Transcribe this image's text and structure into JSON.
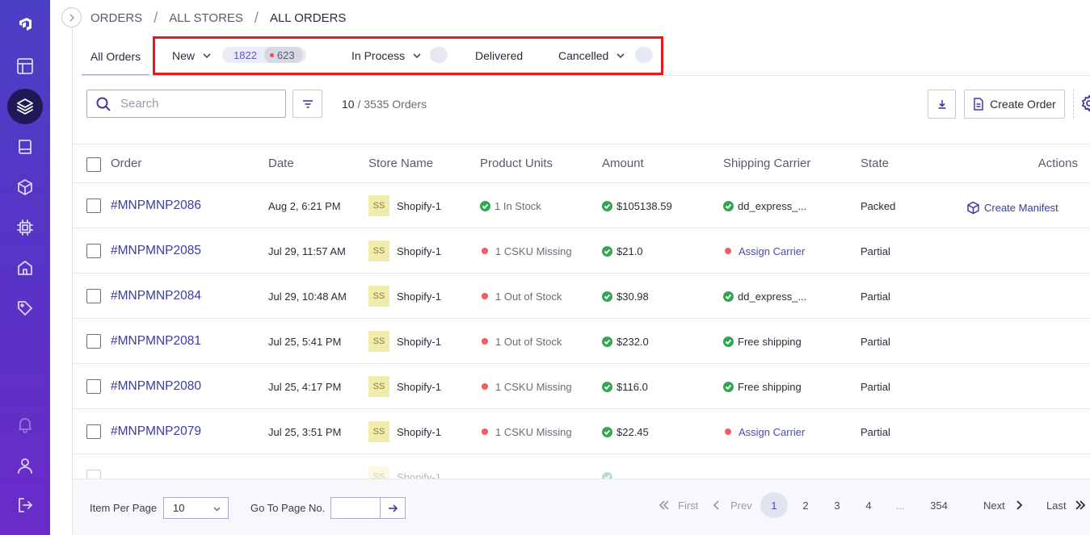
{
  "breadcrumb": {
    "level1": "ORDERS",
    "level2": "ALL STORES",
    "level3": "ALL ORDERS",
    "separator": "/"
  },
  "tabs": {
    "all": "All Orders",
    "new": {
      "label": "New",
      "count_a": "1822",
      "count_b": "623"
    },
    "in_process": {
      "label": "In Process"
    },
    "delivered": {
      "label": "Delivered"
    },
    "cancelled": {
      "label": "Cancelled"
    }
  },
  "toolbar": {
    "search_placeholder": "Search",
    "count_shown": "10",
    "count_total": "/ 3535 Orders",
    "create_label": "Create Order"
  },
  "table": {
    "headers": [
      "Order",
      "Date",
      "Store Name",
      "Product Units",
      "Amount",
      "Shipping Carrier",
      "State",
      "Actions"
    ],
    "rows": [
      {
        "order": "#MNPMNP2086",
        "date": "Aug 2, 6:21 PM",
        "store_abbr": "SS",
        "store": "Shopify-1",
        "units": "1 In Stock",
        "units_ok": true,
        "amount": "$105138.59",
        "carrier": "dd_express_...",
        "carrier_ok": true,
        "state": "Packed",
        "action": "Create Manifest"
      },
      {
        "order": "#MNPMNP2085",
        "date": "Jul 29, 11:57 AM",
        "store_abbr": "SS",
        "store": "Shopify-1",
        "units": "1 CSKU Missing",
        "units_ok": false,
        "amount": "$21.0",
        "carrier": "Assign Carrier",
        "carrier_ok": false,
        "state": "Partial",
        "action": ""
      },
      {
        "order": "#MNPMNP2084",
        "date": "Jul 29, 10:48 AM",
        "store_abbr": "SS",
        "store": "Shopify-1",
        "units": "1 Out of Stock",
        "units_ok": false,
        "amount": "$30.98",
        "carrier": "dd_express_...",
        "carrier_ok": true,
        "state": "Partial",
        "action": ""
      },
      {
        "order": "#MNPMNP2081",
        "date": "Jul 25, 5:41 PM",
        "store_abbr": "SS",
        "store": "Shopify-1",
        "units": "1 Out of Stock",
        "units_ok": false,
        "amount": "$232.0",
        "carrier": "Free shipping",
        "carrier_ok": true,
        "state": "Partial",
        "action": ""
      },
      {
        "order": "#MNPMNP2080",
        "date": "Jul 25, 4:17 PM",
        "store_abbr": "SS",
        "store": "Shopify-1",
        "units": "1 CSKU Missing",
        "units_ok": false,
        "amount": "$116.0",
        "carrier": "Free shipping",
        "carrier_ok": true,
        "state": "Partial",
        "action": ""
      },
      {
        "order": "#MNPMNP2079",
        "date": "Jul 25, 3:51 PM",
        "store_abbr": "SS",
        "store": "Shopify-1",
        "units": "1 CSKU Missing",
        "units_ok": false,
        "amount": "$22.45",
        "carrier": "Assign Carrier",
        "carrier_ok": false,
        "state": "Partial",
        "action": ""
      },
      {
        "order": "",
        "date": "",
        "store_abbr": "SS",
        "store": "Shopify-1",
        "units": "",
        "units_ok": true,
        "amount": "",
        "carrier": "",
        "carrier_ok": true,
        "state": "",
        "action": ""
      }
    ]
  },
  "footer": {
    "per_page_label": "Item Per Page",
    "per_page_value": "10",
    "goto_label": "Go To Page No.",
    "first": "First",
    "prev": "Prev",
    "pages": [
      "1",
      "2",
      "3",
      "4",
      "...",
      "354"
    ],
    "current_page": "1",
    "next": "Next",
    "last": "Last"
  },
  "colors": {
    "sidebar_top": "#4a3fc4",
    "sidebar_bottom": "#6a2bc9",
    "accent": "#3a3d9e",
    "highlight_box": "#e8161f",
    "ok": "#2fa84f",
    "error": "#ef5a64"
  },
  "sidebar_icons": [
    "logo-icon",
    "layout-icon",
    "layers-icon",
    "book-icon",
    "box-icon",
    "chip-icon",
    "home-icon",
    "tag-icon",
    "bell-icon",
    "user-icon",
    "logout-icon"
  ]
}
